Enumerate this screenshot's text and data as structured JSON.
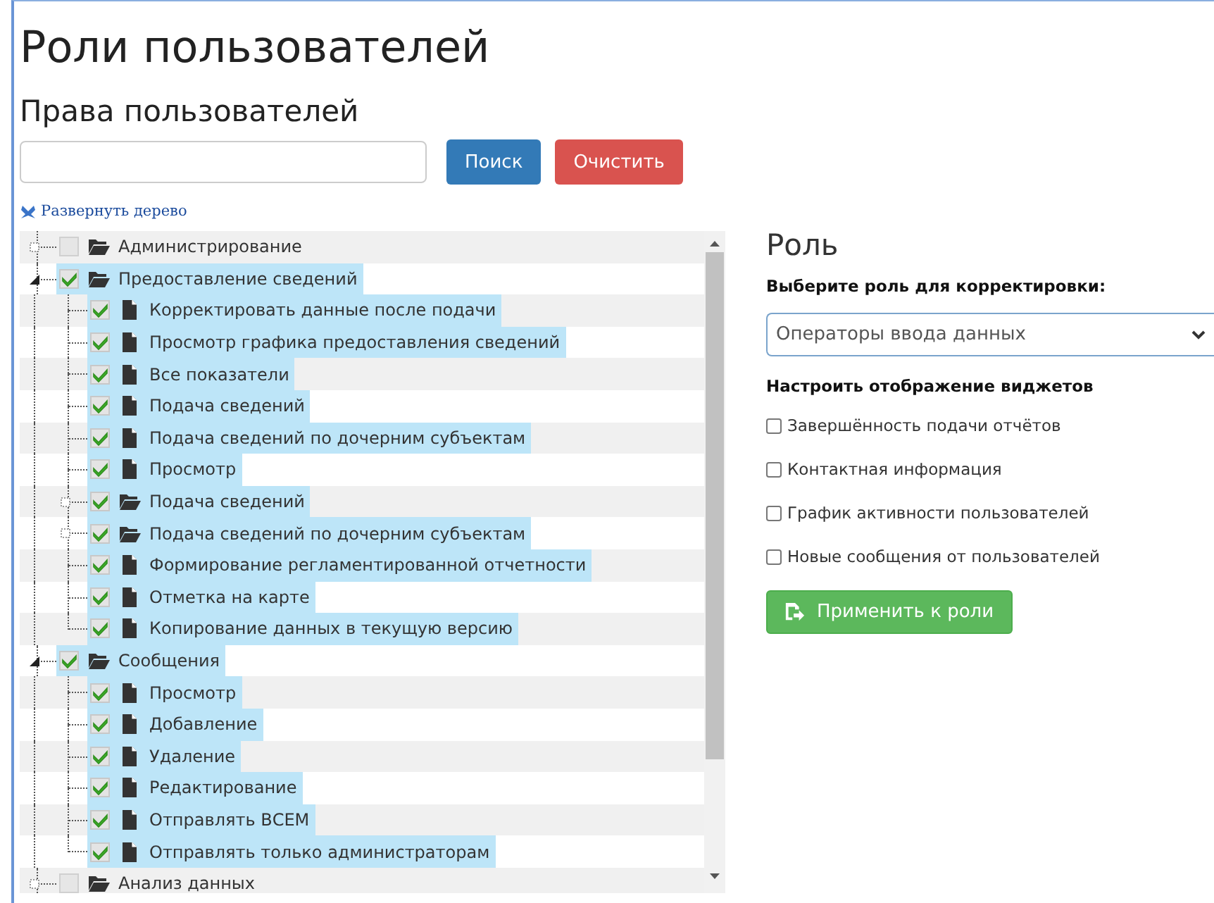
{
  "page": {
    "title": "Роли пользователей"
  },
  "permissions": {
    "heading": "Права пользователей",
    "buttons": [
      {
        "label": "Поиск",
        "kind": "primary"
      },
      {
        "label": "Очистить",
        "kind": "danger"
      }
    ],
    "expand_link": "Развернуть дерево",
    "tree": [
      {
        "label": "Администрирование",
        "kind": "folder",
        "expanded": false,
        "checked": false,
        "selected": false
      },
      {
        "label": "Предоставление сведений",
        "kind": "folder",
        "expanded": true,
        "checked": true,
        "selected": true,
        "children": [
          {
            "label": "Корректировать данные после подачи",
            "kind": "file",
            "checked": true,
            "selected": true
          },
          {
            "label": "Просмотр графика предоставления сведений",
            "kind": "file",
            "checked": true,
            "selected": true
          },
          {
            "label": "Все показатели",
            "kind": "file",
            "checked": true,
            "selected": true
          },
          {
            "label": "Подача сведений",
            "kind": "file",
            "checked": true,
            "selected": true
          },
          {
            "label": "Подача сведений по дочерним субъектам",
            "kind": "file",
            "checked": true,
            "selected": true
          },
          {
            "label": "Просмотр",
            "kind": "file",
            "checked": true,
            "selected": true
          },
          {
            "label": "Подача сведений",
            "kind": "folder",
            "expanded": false,
            "checked": true,
            "selected": true
          },
          {
            "label": "Подача сведений по дочерним субъектам",
            "kind": "folder",
            "expanded": false,
            "checked": true,
            "selected": true
          },
          {
            "label": "Формирование регламентированной отчетности",
            "kind": "file",
            "checked": true,
            "selected": true
          },
          {
            "label": "Отметка на карте",
            "kind": "file",
            "checked": true,
            "selected": true
          },
          {
            "label": "Копирование данных в текущую версию",
            "kind": "file",
            "checked": true,
            "selected": true
          }
        ]
      },
      {
        "label": "Сообщения",
        "kind": "folder",
        "expanded": true,
        "checked": true,
        "selected": true,
        "children": [
          {
            "label": "Просмотр",
            "kind": "file",
            "checked": true,
            "selected": true
          },
          {
            "label": "Добавление",
            "kind": "file",
            "checked": true,
            "selected": true
          },
          {
            "label": "Удаление",
            "kind": "file",
            "checked": true,
            "selected": true
          },
          {
            "label": "Редактирование",
            "kind": "file",
            "checked": true,
            "selected": true
          },
          {
            "label": "Отправлять ВСЕМ",
            "kind": "file",
            "checked": true,
            "selected": true
          },
          {
            "label": "Отправлять только администраторам",
            "kind": "file",
            "checked": true,
            "selected": true
          }
        ]
      },
      {
        "label": "Анализ данных",
        "kind": "folder",
        "expanded": false,
        "checked": false,
        "selected": false
      }
    ]
  },
  "role": {
    "heading": "Роль",
    "select_label": "Выберите роль для корректировки:",
    "select": {
      "value": "Операторы ввода данных"
    },
    "widgets_label": "Настроить отображение виджетов",
    "widgets": [
      {
        "label": "Завершённость подачи отчётов",
        "checked": false
      },
      {
        "label": "Контактная информация",
        "checked": false
      },
      {
        "label": "График активности пользователей",
        "checked": false
      },
      {
        "label": "Новые сообщения от пользователей",
        "checked": false
      }
    ],
    "apply_button": "Применить к роли"
  }
}
